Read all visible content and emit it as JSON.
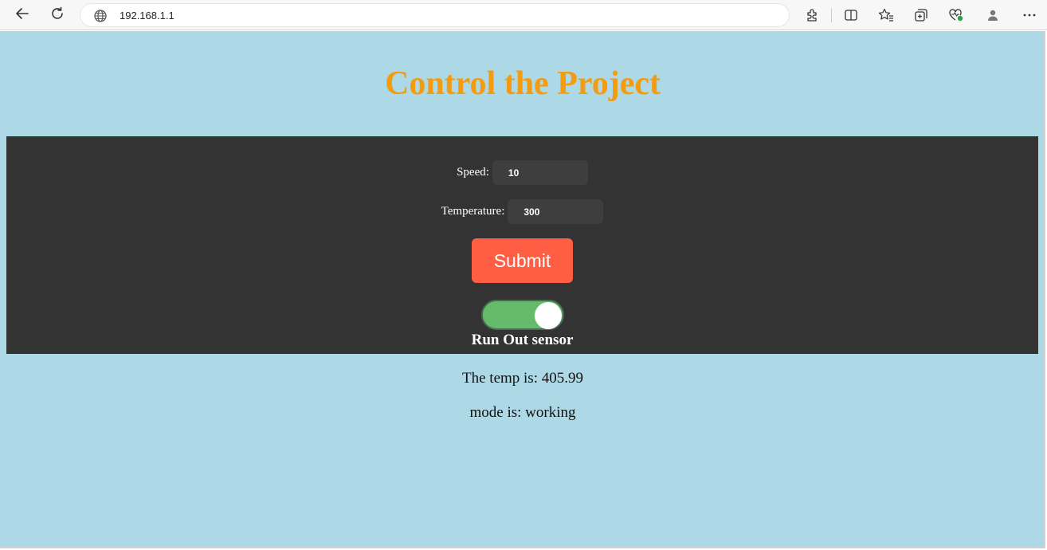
{
  "browser": {
    "url": "192.168.1.1",
    "icons": [
      "back-arrow-icon",
      "refresh-icon",
      "globe-icon",
      "extensions-icon",
      "split-screen-icon",
      "favorites-icon",
      "collections-icon",
      "browser-essentials-icon",
      "profile-icon",
      "more-icon"
    ]
  },
  "page": {
    "title": "Control the Project",
    "title_color": "#f39c12",
    "background": "#add8e6",
    "panel_background": "#333333"
  },
  "form": {
    "speed_label": "Speed:",
    "speed_value": "10",
    "temperature_label": "Temperature:",
    "temperature_value": "300",
    "submit_label": "Submit",
    "submit_color": "#ff5e45"
  },
  "toggle": {
    "label": "Run Out sensor",
    "state": "on",
    "color": "#66bb6a"
  },
  "status": {
    "temp_text": "The temp is: 405.99",
    "mode_text": "mode is: working"
  }
}
